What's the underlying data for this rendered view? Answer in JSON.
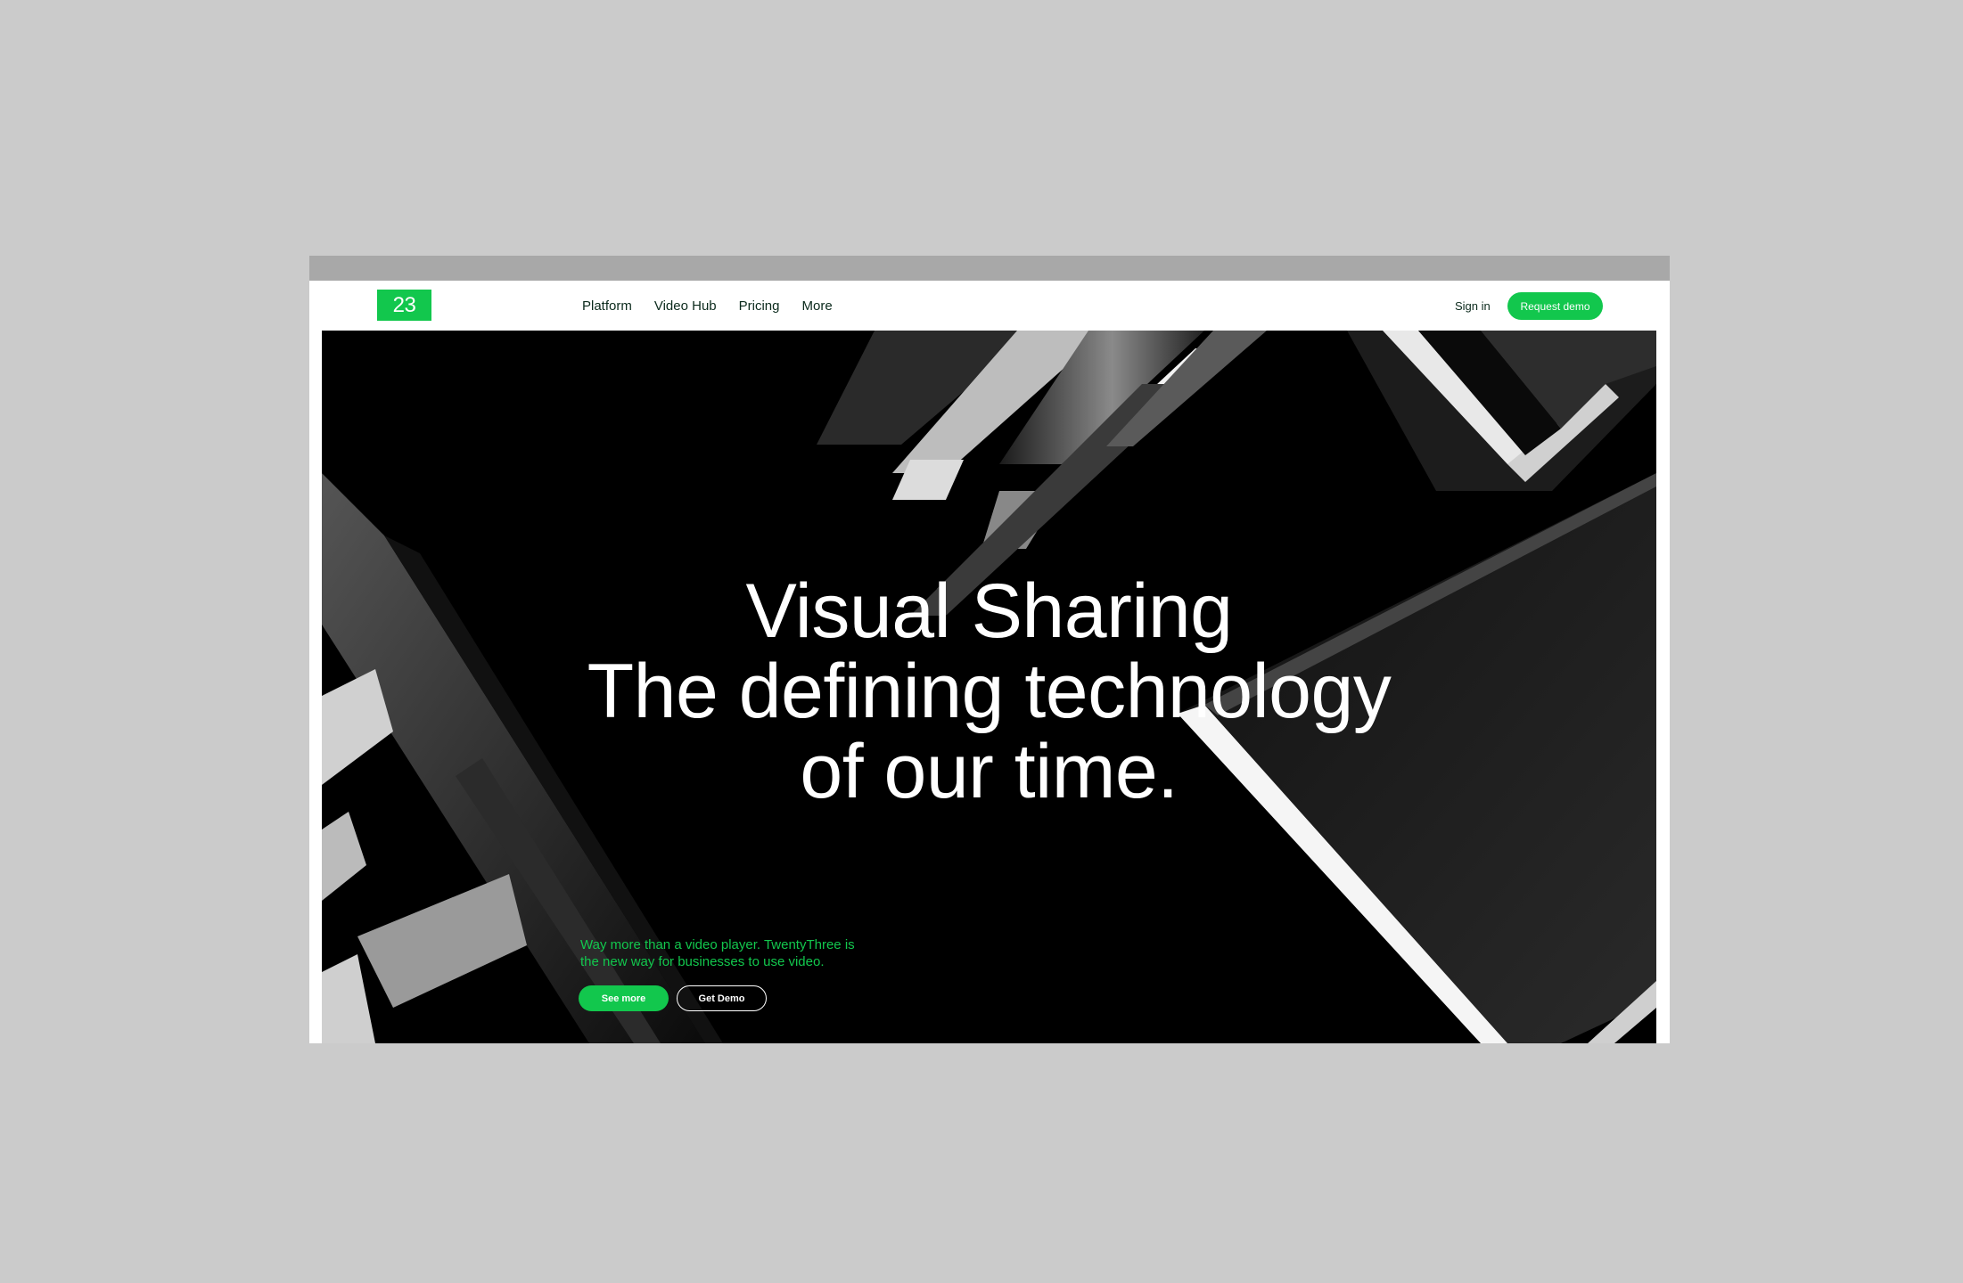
{
  "brand": {
    "logo_text": "23",
    "accent_color": "#12c74d"
  },
  "nav": {
    "items": [
      {
        "label": "Platform"
      },
      {
        "label": "Video Hub"
      },
      {
        "label": "Pricing"
      },
      {
        "label": "More"
      }
    ],
    "sign_in": "Sign in",
    "request_demo": "Request demo"
  },
  "hero": {
    "headline_lines": [
      "Visual Sharing",
      "The defining technology",
      "of our time."
    ],
    "tagline": "Way more than a video player. TwentyThree is the new way for businesses to use video.",
    "primary_cta": "See more",
    "secondary_cta": "Get Demo",
    "background_image": "abstract-architecture-light-beams"
  }
}
